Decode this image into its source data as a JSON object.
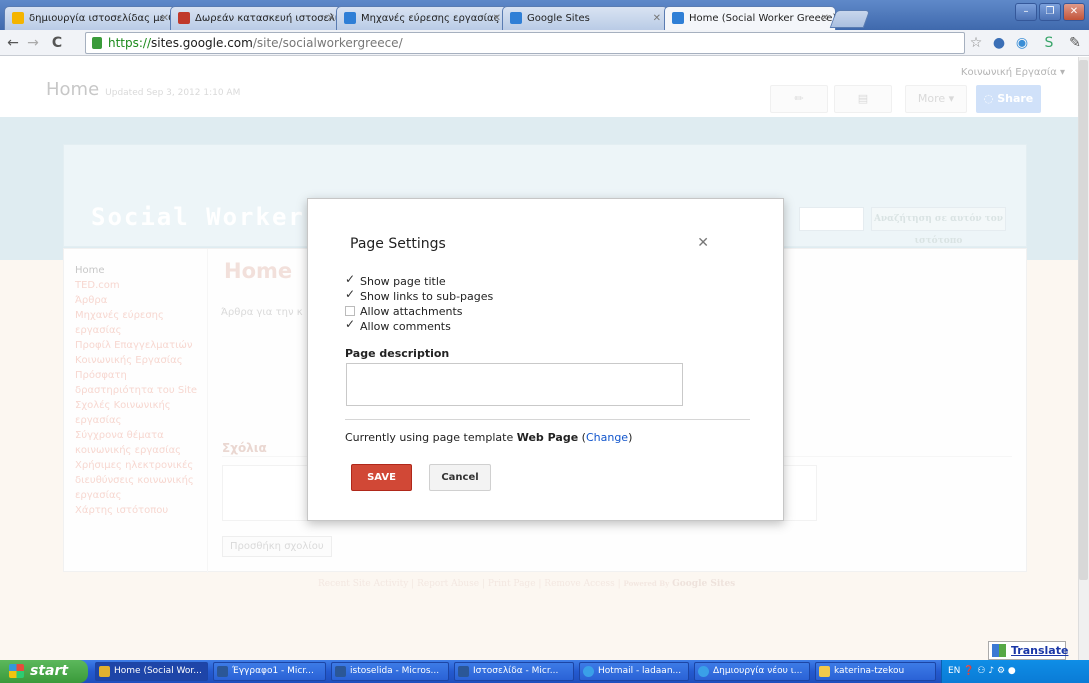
{
  "browser": {
    "tabs": [
      {
        "label": "δημιουργία ιστοσελίδας με Go",
        "icon": "google-favicon",
        "color": "#f4b400"
      },
      {
        "label": "Δωρεάν κατασκευή ιστοσελίδ",
        "icon": "site-favicon",
        "color": "#c0392b"
      },
      {
        "label": "Μηχανές εύρεσης εργασίας - ",
        "icon": "google-sites-favicon",
        "color": "#2f7fd6"
      },
      {
        "label": "Google Sites",
        "icon": "google-sites-favicon",
        "color": "#2f7fd6"
      },
      {
        "label": "Home (Social Worker Greece)",
        "icon": "google-sites-favicon",
        "color": "#2f7fd6"
      }
    ],
    "url": {
      "proto": "https://",
      "host": "sites.google.com",
      "path": "/site/socialworkergreece/"
    }
  },
  "sites_header": {
    "page_name": "Home",
    "updated": "Updated Sep 3, 2012 1:10 AM",
    "user": "Κοινωνική Εργασία ▾",
    "more": "More ▾",
    "share": "Share"
  },
  "site": {
    "title": "Social Worker",
    "search_button": "Αναζήτηση σε αυτόν τον ιστότοπο",
    "nav": [
      "Home",
      "TED.com",
      "Άρθρα",
      "Μηχανές εύρεσης",
      "εργασίας",
      "Προφίλ Επαγγελματιών",
      "Κοινωνικής Εργασίας",
      "Πρόσφατη",
      "δραστηριότητα του Site",
      "Σχολές Κοινωνικής",
      "εργασίας",
      "Σύγχρονα θέματα",
      "κοινωνικής εργασίας",
      "Χρήσιμες ηλεκτρονικές",
      "διευθύνσεις κοινωνικής",
      "εργασίας",
      "Χάρτης ιστότοπου"
    ],
    "main_title": "Home",
    "main_text": "Άρθρα για την κ",
    "comments_heading": "Σχόλια",
    "add_comment": "Προσθήκη σχολίου",
    "footer": {
      "recent": "Recent Site Activity",
      "report": "Report Abuse",
      "print": "Print Page",
      "remove": "Remove Access",
      "powered": "Powered By",
      "brand": "Google Sites"
    }
  },
  "dialog": {
    "title": "Page Settings",
    "options": [
      {
        "label": "Show page title",
        "checked": true
      },
      {
        "label": "Show links to sub-pages",
        "checked": true
      },
      {
        "label": "Allow attachments",
        "checked": false
      },
      {
        "label": "Allow comments",
        "checked": true
      }
    ],
    "description_label": "Page description",
    "template_prefix": "Currently using page template",
    "template_name": "Web Page",
    "change_link": "Change",
    "save": "SAVE",
    "cancel": "Cancel"
  },
  "translate": "Translate",
  "taskbar": {
    "start": "start",
    "tasks": [
      {
        "label": "Home (Social Wor...",
        "icon": "chrome-icon",
        "color": "#e0b02f"
      },
      {
        "label": "Έγγραφο1 - Micr...",
        "icon": "word-icon",
        "color": "#2b5797"
      },
      {
        "label": "istoselida - Micros...",
        "icon": "word-icon",
        "color": "#2b5797"
      },
      {
        "label": "Ιστοσελίδα - Micr...",
        "icon": "word-icon",
        "color": "#2b5797"
      },
      {
        "label": "Hotmail - ladaan...",
        "icon": "ie-icon",
        "color": "#3aa0e8"
      },
      {
        "label": "Δημιουργία νέου ι...",
        "icon": "ie-icon",
        "color": "#3aa0e8"
      },
      {
        "label": "katerina-tzekou",
        "icon": "folder-icon",
        "color": "#f2c94c"
      }
    ],
    "tray_lang": "EN"
  }
}
